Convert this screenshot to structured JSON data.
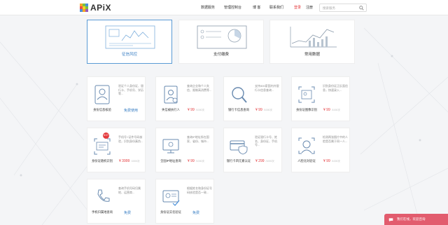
{
  "header": {
    "logo_text": "APiX",
    "nav": [
      "数据服务",
      "管理控制台",
      "博 客",
      "联系我们"
    ],
    "login": "登录",
    "register": "注册",
    "search_placeholder": "搜索服务"
  },
  "categories": [
    {
      "label": "征信风控",
      "active": true
    },
    {
      "label": "支付缴费",
      "active": false
    },
    {
      "label": "常用数据",
      "active": false
    }
  ],
  "cards": [
    {
      "name": "身份信息核验",
      "desc": "验证个人身份证、银行卡、手机号、学历等...",
      "price": "",
      "free": "免费使用"
    },
    {
      "name": "失信被执行人",
      "desc": "查询企业和个人失信、限制高消费等...",
      "price": "¥ 99",
      "unit": "/1000次",
      "free": ""
    },
    {
      "name": "银行卡信息查询",
      "desc": "支持300家国内外银行卡信息查询...",
      "price": "¥ 99",
      "unit": "/1000次",
      "free": ""
    },
    {
      "name": "身份证图像识别",
      "desc": "识别身份证正反面信息，快速录入...",
      "price": "¥ 99",
      "unit": "/1000次",
      "free": ""
    },
    {
      "name": "身份证随机识别",
      "desc": "手机号+证件号码核验，识别身份真伪...",
      "price": "¥ 3999",
      "unit": "/1000次",
      "free": "",
      "badge": "HOT"
    },
    {
      "name": "全国IP地址查询",
      "desc": "查询IP地址所在国家、省份、城市...",
      "price": "¥ 99",
      "unit": "/1000次",
      "free": ""
    },
    {
      "name": "银行卡四元素认证",
      "desc": "验证银行卡号、姓名、身份证、手机号...",
      "price": "¥ 299",
      "unit": "/1000次",
      "free": ""
    },
    {
      "name": "人脸比对验证",
      "desc": "检测两张图片中的人脸是否属于同一人...",
      "price": "¥ 99",
      "unit": "/1000次",
      "free": ""
    },
    {
      "name": "手机归属地查询",
      "desc": "查询手机号码归属地、运营商...",
      "price": "",
      "free": "免费"
    },
    {
      "name": "身份证实名验证",
      "desc": "根据姓名和身份证号码核验是否一致...",
      "price": "",
      "free": "免费"
    }
  ],
  "chat": {
    "label": "我们在线，欢迎咨询"
  },
  "colors": {
    "accent": "#3a7fc4",
    "price": "#e4393c",
    "chat": "#e25c6e"
  }
}
